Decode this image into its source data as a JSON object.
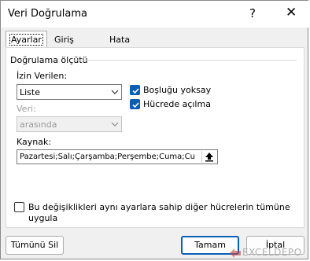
{
  "window": {
    "title": "Veri Doğrulama",
    "help_label": "?",
    "close_label": "✕"
  },
  "tabs": [
    {
      "label": "Ayarlar",
      "active": true
    },
    {
      "label": "Giriş İletisi",
      "active": false
    },
    {
      "label": "Hata Uyarısı",
      "active": false
    }
  ],
  "criteria": {
    "group_label": "Doğrulama ölçütü",
    "allow_label": "İzin Verilen:",
    "allow_value": "Liste",
    "data_label": "Veri:",
    "data_value": "arasında",
    "ignore_blank_label": "Boşluğu yoksay",
    "ignore_blank_checked": true,
    "in_cell_dropdown_label": "Hücrede açılma",
    "in_cell_dropdown_checked": true,
    "source_label": "Kaynak:",
    "source_value": "Pazartesi;Salı;Çarşamba;Perşembe;Cuma;Cu"
  },
  "apply_all": {
    "label_line1": "Bu değişiklikleri aynı ayarlara sahip diğer hücrelerin tümüne",
    "label_line2": "uygula",
    "checked": false
  },
  "buttons": {
    "clear_all": "Tümünü Sil",
    "ok": "Tamam",
    "cancel": "İptal"
  },
  "watermark": {
    "text": "EXCELDEPO"
  },
  "colors": {
    "accent": "#0a5fb4",
    "watermark": "#c04040"
  }
}
